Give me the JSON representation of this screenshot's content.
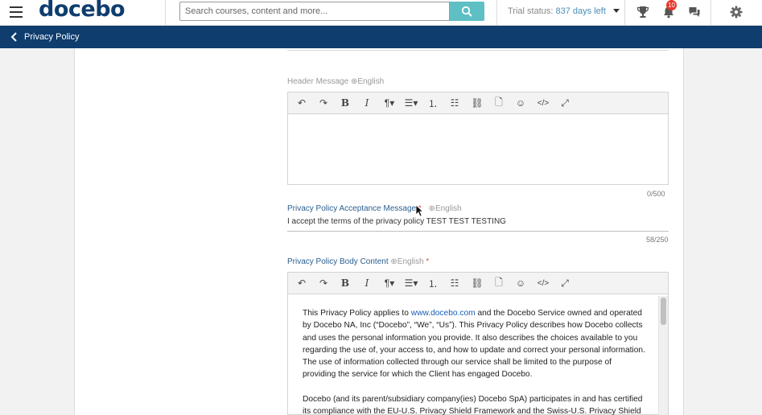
{
  "header": {
    "logo_text": "docebo",
    "logo_mark": "®",
    "search_placeholder": "Search courses, content and more...",
    "trial_prefix": "Trial status:",
    "trial_days": "837 days left",
    "notification_count": "10",
    "icons": [
      "menu-icon",
      "search-icon",
      "trophy-icon",
      "bell-icon",
      "chat-icon",
      "gear-icon"
    ]
  },
  "subbar": {
    "title": "Privacy Policy"
  },
  "fields": {
    "header_message": {
      "label": "Header Message",
      "lang": "English",
      "counter": "0/500"
    },
    "acceptance": {
      "label": "Privacy Policy Acceptance Message",
      "required": "*",
      "lang": "English",
      "value": "I accept the terms of the privacy policy TEST TEST TESTING",
      "counter": "58/250"
    },
    "body_content": {
      "label": "Privacy Policy Body Content",
      "required": "*",
      "lang": "English",
      "p1_a": "This Privacy Policy applies to ",
      "p1_link": "www.docebo.com",
      "p1_b": " and the Docebo Service owned and operated by Docebo NA, Inc (“Docebo”, “We”, “Us”). This Privacy Policy describes how Docebo collects and uses the personal information you provide. It also describes the choices available to you regarding the use of, your access to, and how to update and correct your personal information. The use of information collected through our service shall be limited to the purpose of providing the service for which the Client has engaged Docebo.",
      "p2": "Docebo (and its parent/subsidiary company(ies) Docebo SpA) participates in and has certified its compliance with the EU-U.S. Privacy Shield Framework and the Swiss-U.S. Privacy Shield"
    }
  },
  "toolbar_buttons": [
    "undo",
    "redo",
    "bold",
    "italic",
    "paragraph",
    "align",
    "ordered-list",
    "bullet-list",
    "link",
    "file",
    "emoji",
    "code",
    "fullscreen"
  ],
  "colors": {
    "brand_navy": "#0e3d6e",
    "search_button": "#5ebfc4",
    "badge": "#e8362a",
    "required": "#d9534f"
  }
}
